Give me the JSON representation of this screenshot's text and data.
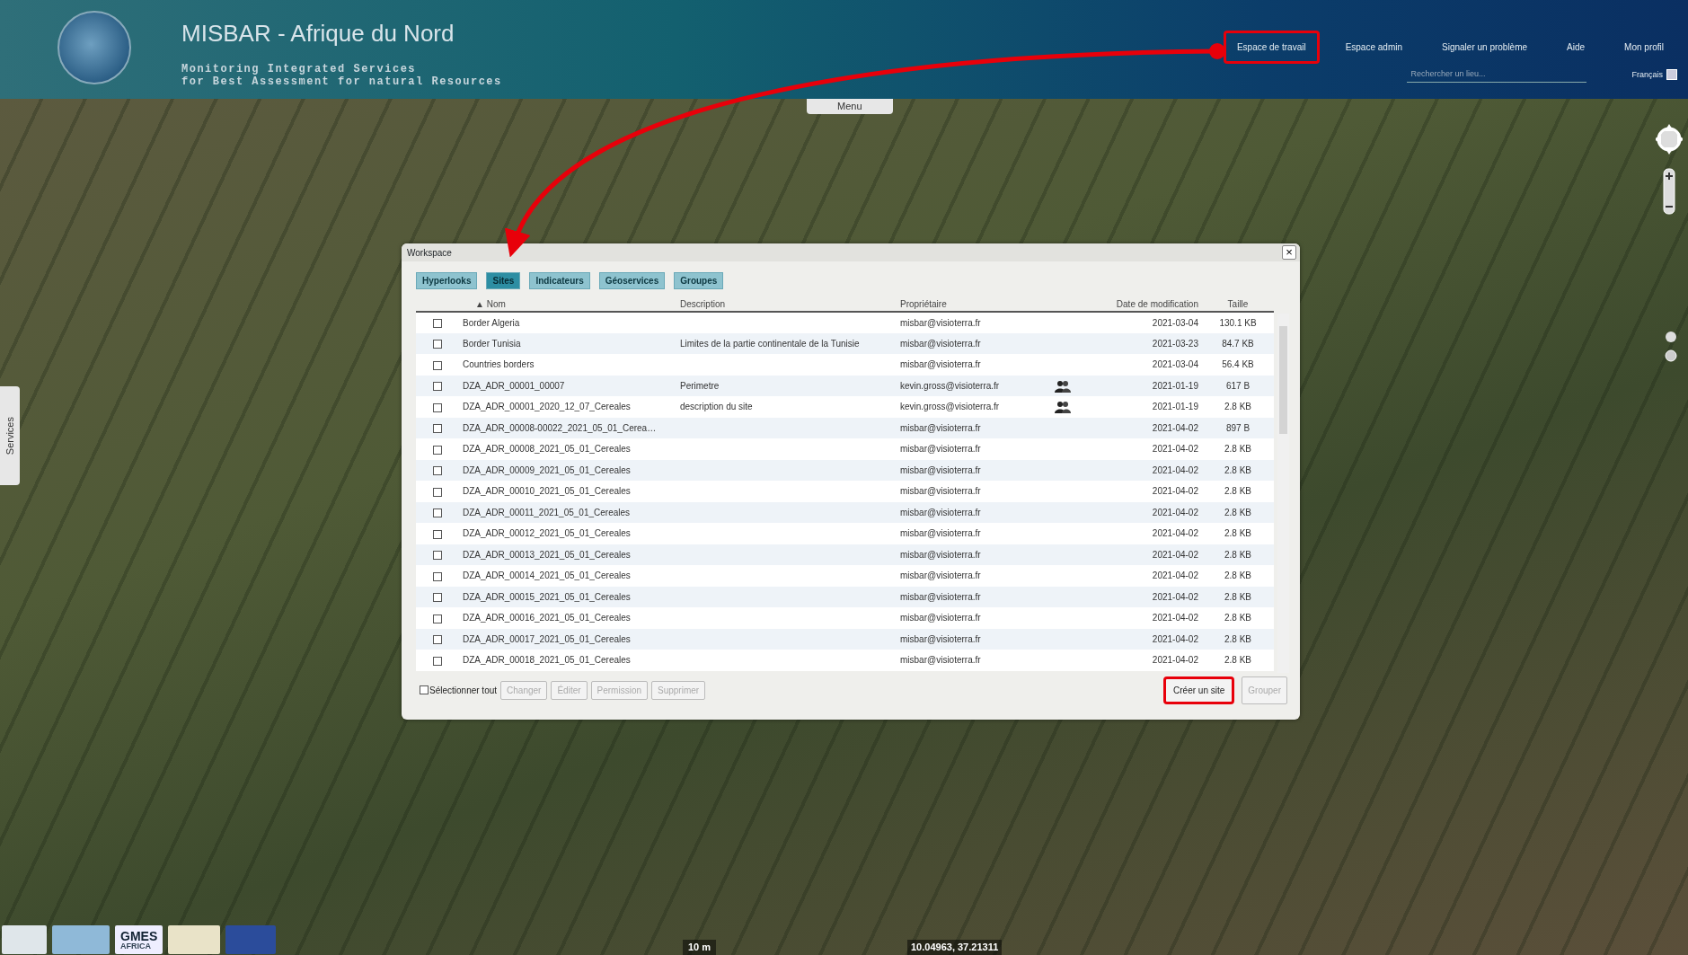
{
  "header": {
    "title": "MISBAR - Afrique du Nord",
    "subtitle_lines": [
      "Monitoring Integrated Services",
      "for Best Assessment for natural Resources"
    ],
    "nav": [
      {
        "label": "Espace de travail",
        "highlighted": true
      },
      {
        "label": "Espace admin",
        "highlighted": false
      },
      {
        "label": "Signaler un problème",
        "highlighted": false
      },
      {
        "label": "Aide",
        "highlighted": false
      },
      {
        "label": "Mon profil",
        "highlighted": false
      }
    ],
    "search": {
      "placeholder": "Rechercher un lieu..."
    },
    "language": "Français"
  },
  "menu_tab": "Menu",
  "side_tab": "Services",
  "dialog": {
    "title": "Workspace",
    "close": "×",
    "tabs": [
      {
        "label": "Hyperlooks",
        "selected": false
      },
      {
        "label": "Sites",
        "selected": true
      },
      {
        "label": "Indicateurs",
        "selected": false
      },
      {
        "label": "Géoservices",
        "selected": false
      },
      {
        "label": "Groupes",
        "selected": false
      }
    ],
    "table": {
      "sort_mark": "▲",
      "columns": [
        "Nom",
        "Description",
        "Propriétaire",
        "Date de modification",
        "Taille"
      ],
      "rows": [
        {
          "checked": false,
          "name": "Border Algeria",
          "description": "",
          "owner": "misbar@visioterra.fr",
          "shared": false,
          "date": "2021-03-04",
          "size": "130.1 KB"
        },
        {
          "checked": false,
          "name": "Border Tunisia",
          "description": "Limites de la partie continentale de la Tunisie",
          "owner": "misbar@visioterra.fr",
          "shared": false,
          "date": "2021-03-23",
          "size": "84.7 KB"
        },
        {
          "checked": false,
          "name": "Countries borders",
          "description": "",
          "owner": "misbar@visioterra.fr",
          "shared": false,
          "date": "2021-03-04",
          "size": "56.4 KB"
        },
        {
          "checked": false,
          "name": "DZA_ADR_00001_00007",
          "description": "Perimetre",
          "owner": "kevin.gross@visioterra.fr",
          "shared": true,
          "date": "2021-01-19",
          "size": "617 B"
        },
        {
          "checked": false,
          "name": "DZA_ADR_00001_2020_12_07_Cereales",
          "description": "description du site",
          "owner": "kevin.gross@visioterra.fr",
          "shared": true,
          "date": "2021-01-19",
          "size": "2.8 KB"
        },
        {
          "checked": false,
          "name": "DZA_ADR_00008-00022_2021_05_01_Cerea…",
          "description": "",
          "owner": "misbar@visioterra.fr",
          "shared": false,
          "date": "2021-04-02",
          "size": "897 B"
        },
        {
          "checked": false,
          "name": "DZA_ADR_00008_2021_05_01_Cereales",
          "description": "",
          "owner": "misbar@visioterra.fr",
          "shared": false,
          "date": "2021-04-02",
          "size": "2.8 KB"
        },
        {
          "checked": false,
          "name": "DZA_ADR_00009_2021_05_01_Cereales",
          "description": "",
          "owner": "misbar@visioterra.fr",
          "shared": false,
          "date": "2021-04-02",
          "size": "2.8 KB"
        },
        {
          "checked": false,
          "name": "DZA_ADR_00010_2021_05_01_Cereales",
          "description": "",
          "owner": "misbar@visioterra.fr",
          "shared": false,
          "date": "2021-04-02",
          "size": "2.8 KB"
        },
        {
          "checked": false,
          "name": "DZA_ADR_00011_2021_05_01_Cereales",
          "description": "",
          "owner": "misbar@visioterra.fr",
          "shared": false,
          "date": "2021-04-02",
          "size": "2.8 KB"
        },
        {
          "checked": false,
          "name": "DZA_ADR_00012_2021_05_01_Cereales",
          "description": "",
          "owner": "misbar@visioterra.fr",
          "shared": false,
          "date": "2021-04-02",
          "size": "2.8 KB"
        },
        {
          "checked": false,
          "name": "DZA_ADR_00013_2021_05_01_Cereales",
          "description": "",
          "owner": "misbar@visioterra.fr",
          "shared": false,
          "date": "2021-04-02",
          "size": "2.8 KB"
        },
        {
          "checked": false,
          "name": "DZA_ADR_00014_2021_05_01_Cereales",
          "description": "",
          "owner": "misbar@visioterra.fr",
          "shared": false,
          "date": "2021-04-02",
          "size": "2.8 KB"
        },
        {
          "checked": false,
          "name": "DZA_ADR_00015_2021_05_01_Cereales",
          "description": "",
          "owner": "misbar@visioterra.fr",
          "shared": false,
          "date": "2021-04-02",
          "size": "2.8 KB"
        },
        {
          "checked": false,
          "name": "DZA_ADR_00016_2021_05_01_Cereales",
          "description": "",
          "owner": "misbar@visioterra.fr",
          "shared": false,
          "date": "2021-04-02",
          "size": "2.8 KB"
        },
        {
          "checked": false,
          "name": "DZA_ADR_00017_2021_05_01_Cereales",
          "description": "",
          "owner": "misbar@visioterra.fr",
          "shared": false,
          "date": "2021-04-02",
          "size": "2.8 KB"
        },
        {
          "checked": false,
          "name": "DZA_ADR_00018_2021_05_01_Cereales",
          "description": "",
          "owner": "misbar@visioterra.fr",
          "shared": false,
          "date": "2021-04-02",
          "size": "2.8 KB"
        }
      ]
    },
    "select_all": {
      "label": "Sélectionner tout",
      "checked": false
    },
    "actions": [
      {
        "label": "Changer",
        "disabled": true,
        "highlighted": false
      },
      {
        "label": "Éditer",
        "disabled": true,
        "highlighted": false
      },
      {
        "label": "Permission",
        "disabled": true,
        "highlighted": false
      },
      {
        "label": "Supprimer",
        "disabled": true,
        "highlighted": false
      }
    ],
    "right_actions": [
      {
        "label": "Créer un site",
        "disabled": false,
        "highlighted": true
      },
      {
        "label": "Grouper",
        "disabled": true,
        "highlighted": false
      }
    ]
  },
  "footer": {
    "logo_text": [
      "GMES",
      "AFRICA"
    ],
    "scale": "10 m",
    "coordinates": "10.04963, 37.21311"
  }
}
